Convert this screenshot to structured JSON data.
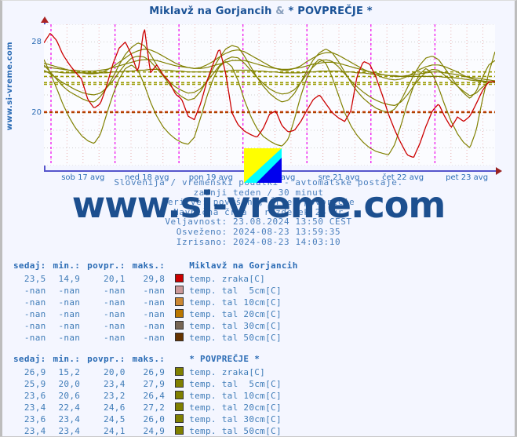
{
  "page": {
    "title": "Miklavž na Gorjancih & * POVPREČJE *",
    "title_left": "Miklavž na Gorjancih",
    "title_amp": "&",
    "title_right": "* POVPREČJE *",
    "vertical_watermark": "www.si-vreme.com",
    "big_watermark": "www.si-vreme.com",
    "logo_name": "si-vreme-logo"
  },
  "footer": {
    "line1": "Slovenija / vremenski podatki - avtomatske postaje.",
    "line2": "zadnji teden / 30 minut",
    "line3": "Meritve: površina, Črte: povprečje",
    "line4": "Navpična črta - razdelek 24 ur",
    "line5": "Veljavnost: 23.08.2024 13:50 CEST",
    "line6": "Osveženo: 2024-08-23 13:59:35",
    "line7": "Izrisano: 2024-08-23 14:03:10"
  },
  "chart_data": {
    "type": "line",
    "title": "Miklavž na Gorjancih & * POVPREČJE *",
    "xlabel": "",
    "ylabel": "",
    "ylim": [
      14,
      30
    ],
    "yticks": [
      20,
      28
    ],
    "ytick_labels": [
      "20",
      "28"
    ],
    "grid": true,
    "legend_position": "below-table",
    "x_tick_labels": [
      "sob 17 avg",
      "ned 18 avg",
      "pon 19 avg",
      "tor 20 avg",
      "sre 21 avg",
      "čet 22 avg",
      "pet 23 avg"
    ],
    "x_range": "2024-08-16 .. 2024-08-23",
    "series": [
      {
        "name": "Miklavž na Gorjancih temp. zraka[C]",
        "color": "#cc0000",
        "now": 23.5,
        "min": 14.9,
        "avg": 20.1,
        "max": 29.8,
        "values": [
          27.9,
          29.0,
          28.2,
          26.6,
          25.5,
          24.6,
          23.8,
          21.5,
          20.5,
          21.0,
          23.0,
          25.5,
          27.3,
          28.0,
          26.5,
          24.5,
          29.8,
          24.5,
          25.4,
          24.3,
          23.5,
          22.1,
          21.5,
          19.6,
          19.2,
          21.0,
          23.5,
          25.5,
          27.3,
          24.5,
          20.0,
          18.6,
          17.9,
          17.5,
          17.2,
          18.2,
          19.8,
          20.2,
          18.5,
          17.8,
          18.0,
          19.0,
          20.3,
          21.5,
          22.0,
          21.0,
          20.0,
          19.4,
          19.0,
          20.2,
          24.2,
          25.8,
          25.5,
          24.0,
          22.0,
          19.8,
          18.0,
          16.5,
          15.2,
          14.9,
          16.5,
          18.5,
          20.2,
          21.0,
          19.5,
          18.3,
          19.5,
          19.0,
          19.6,
          21.0,
          22.5,
          23.5,
          23.5
        ]
      },
      {
        "name": "Miklavž na Gorjancih temp. tal  5cm[C]",
        "color": "#cc9999",
        "now": "-nan",
        "min": "-nan",
        "avg": "-nan",
        "max": "-nan",
        "values": []
      },
      {
        "name": "Miklavž na Gorjancih temp. tal 10cm[C]",
        "color": "#cc8833",
        "now": "-nan",
        "min": "-nan",
        "avg": "-nan",
        "max": "-nan",
        "values": []
      },
      {
        "name": "Miklavž na Gorjancih temp. tal 20cm[C]",
        "color": "#bb7700",
        "now": "-nan",
        "min": "-nan",
        "avg": "-nan",
        "max": "-nan",
        "values": []
      },
      {
        "name": "Miklavž na Gorjancih temp. tal 30cm[C]",
        "color": "#776655",
        "now": "-nan",
        "min": "-nan",
        "avg": "-nan",
        "max": "-nan",
        "values": []
      },
      {
        "name": "Miklavž na Gorjancih temp. tal 50cm[C]",
        "color": "#663300",
        "now": "-nan",
        "min": "-nan",
        "avg": "-nan",
        "max": "-nan",
        "values": []
      },
      {
        "name": "* POVPREČJE * temp. zraka[C]",
        "color": "#808000",
        "now": 26.9,
        "min": 15.2,
        "avg": 20.0,
        "max": 26.9,
        "values": [
          26.0,
          24.5,
          22.8,
          21.0,
          19.5,
          18.3,
          17.4,
          16.8,
          16.5,
          17.5,
          19.8,
          22.0,
          23.8,
          25.0,
          25.4,
          24.8,
          23.2,
          21.2,
          19.6,
          18.4,
          17.6,
          17.0,
          16.6,
          16.4,
          17.2,
          19.4,
          21.8,
          23.8,
          25.2,
          25.8,
          25.2,
          23.6,
          21.4,
          19.6,
          18.2,
          17.3,
          16.8,
          16.4,
          16.2,
          17.0,
          19.3,
          21.9,
          24.0,
          25.4,
          26.1,
          25.6,
          24.0,
          22.0,
          20.0,
          18.5,
          17.4,
          16.6,
          16.0,
          15.6,
          15.4,
          15.2,
          16.4,
          18.6,
          21.0,
          23.0,
          24.4,
          25.0,
          24.4,
          22.8,
          20.8,
          19.0,
          17.6,
          16.6,
          16.0,
          18.0,
          21.5,
          24.5,
          26.9
        ]
      },
      {
        "name": "* POVPREČJE * temp. tal  5cm[C]",
        "color": "#808000",
        "now": 25.9,
        "min": 20.0,
        "avg": 23.4,
        "max": 27.9,
        "values": [
          25.4,
          24.6,
          23.8,
          23.0,
          22.4,
          22.0,
          21.6,
          21.3,
          21.2,
          21.8,
          22.8,
          24.0,
          25.4,
          26.6,
          27.4,
          27.9,
          27.6,
          26.6,
          25.4,
          24.2,
          23.2,
          22.4,
          21.8,
          21.4,
          21.6,
          22.4,
          23.6,
          25.0,
          26.2,
          27.2,
          27.6,
          27.4,
          26.4,
          25.2,
          24.0,
          23.0,
          22.2,
          21.6,
          21.2,
          21.4,
          22.2,
          23.4,
          24.8,
          26.0,
          26.8,
          27.2,
          26.8,
          25.8,
          24.6,
          23.4,
          22.4,
          21.6,
          21.0,
          20.5,
          20.2,
          20.0,
          20.4,
          21.4,
          22.8,
          24.2,
          25.4,
          26.2,
          26.4,
          26.0,
          25.0,
          24.0,
          23.0,
          22.2,
          21.6,
          22.4,
          24.0,
          25.4,
          25.9
        ]
      },
      {
        "name": "* POVPREČJE * temp. tal 10cm[C]",
        "color": "#808000",
        "now": 23.6,
        "min": 20.6,
        "avg": 23.2,
        "max": 26.4,
        "values": [
          24.8,
          24.4,
          23.9,
          23.4,
          23.0,
          22.6,
          22.3,
          22.1,
          22.0,
          22.2,
          22.8,
          23.6,
          24.6,
          25.5,
          26.2,
          26.4,
          26.3,
          25.8,
          25.0,
          24.2,
          23.5,
          22.9,
          22.5,
          22.2,
          22.3,
          22.7,
          23.5,
          24.4,
          25.3,
          26.0,
          26.3,
          26.2,
          25.6,
          24.8,
          24.0,
          23.3,
          22.7,
          22.3,
          22.1,
          22.2,
          22.6,
          23.4,
          24.4,
          25.2,
          25.8,
          26.0,
          25.8,
          25.2,
          24.4,
          23.6,
          22.9,
          22.3,
          21.8,
          21.4,
          21.1,
          20.9,
          20.8,
          21.2,
          22.0,
          23.0,
          23.9,
          24.6,
          24.9,
          24.8,
          24.2,
          23.6,
          23.0,
          22.4,
          21.9,
          22.2,
          22.9,
          23.4,
          23.6
        ]
      },
      {
        "name": "* POVPREČJE * temp. tal 20cm[C]",
        "color": "#808000",
        "now": 23.4,
        "min": 22.4,
        "avg": 24.6,
        "max": 27.2,
        "values": [
          25.6,
          25.4,
          25.2,
          25.0,
          24.8,
          24.6,
          24.5,
          24.4,
          24.4,
          24.5,
          24.8,
          25.2,
          25.7,
          26.2,
          26.7,
          27.0,
          27.2,
          27.1,
          26.8,
          26.4,
          26.0,
          25.6,
          25.3,
          25.1,
          25.0,
          25.1,
          25.4,
          25.8,
          26.3,
          26.7,
          27.0,
          27.1,
          26.9,
          26.5,
          26.1,
          25.7,
          25.3,
          25.0,
          24.8,
          24.8,
          25.0,
          25.3,
          25.8,
          26.2,
          26.6,
          26.8,
          26.8,
          26.5,
          26.1,
          25.7,
          25.3,
          24.9,
          24.6,
          24.3,
          24.0,
          23.8,
          23.7,
          23.8,
          24.1,
          24.5,
          24.9,
          25.2,
          25.4,
          25.4,
          25.2,
          24.9,
          24.6,
          24.2,
          23.9,
          23.7,
          23.6,
          23.5,
          23.4
        ]
      },
      {
        "name": "* POVPREČJE * temp. tal 30cm[C]",
        "color": "#808000",
        "now": 23.6,
        "min": 23.4,
        "avg": 24.5,
        "max": 26.0,
        "values": [
          25.2,
          25.1,
          25.0,
          24.9,
          24.8,
          24.8,
          24.7,
          24.7,
          24.7,
          24.8,
          24.9,
          25.1,
          25.3,
          25.5,
          25.7,
          25.9,
          26.0,
          26.0,
          25.9,
          25.7,
          25.5,
          25.3,
          25.2,
          25.1,
          25.0,
          25.0,
          25.1,
          25.3,
          25.5,
          25.7,
          25.9,
          25.9,
          25.9,
          25.7,
          25.5,
          25.3,
          25.1,
          25.0,
          24.9,
          24.9,
          25.0,
          25.1,
          25.3,
          25.5,
          25.6,
          25.7,
          25.7,
          25.6,
          25.4,
          25.2,
          25.0,
          24.8,
          24.6,
          24.5,
          24.3,
          24.2,
          24.1,
          24.1,
          24.2,
          24.3,
          24.4,
          24.5,
          24.6,
          24.6,
          24.5,
          24.4,
          24.3,
          24.1,
          24.0,
          23.9,
          23.8,
          23.7,
          23.6
        ]
      },
      {
        "name": "* POVPREČJE * temp. tal 50cm[C]",
        "color": "#808000",
        "now": 23.4,
        "min": 23.4,
        "avg": 24.1,
        "max": 24.9,
        "values": [
          24.6,
          24.6,
          24.6,
          24.5,
          24.5,
          24.5,
          24.5,
          24.5,
          24.5,
          24.5,
          24.5,
          24.6,
          24.6,
          24.7,
          24.7,
          24.8,
          24.8,
          24.9,
          24.9,
          24.8,
          24.8,
          24.7,
          24.7,
          24.6,
          24.6,
          24.6,
          24.6,
          24.6,
          24.7,
          24.7,
          24.8,
          24.8,
          24.8,
          24.8,
          24.7,
          24.7,
          24.6,
          24.6,
          24.5,
          24.5,
          24.5,
          24.5,
          24.6,
          24.6,
          24.7,
          24.7,
          24.7,
          24.7,
          24.6,
          24.6,
          24.5,
          24.5,
          24.4,
          24.3,
          24.3,
          24.2,
          24.2,
          24.1,
          24.1,
          24.1,
          24.1,
          24.1,
          24.1,
          24.1,
          24.0,
          24.0,
          23.9,
          23.8,
          23.7,
          23.6,
          23.5,
          23.5,
          23.4
        ]
      }
    ],
    "avg_reference_lines": [
      {
        "value": 24.6,
        "color": "#9a9a00"
      },
      {
        "value": 24.1,
        "color": "#9a9a00"
      },
      {
        "value": 23.4,
        "color": "#9a9a00"
      },
      {
        "value": 23.2,
        "color": "#9a9a00"
      },
      {
        "value": 20.1,
        "color": "#cc3300"
      },
      {
        "value": 20.0,
        "color": "#aa4400"
      }
    ]
  },
  "tables": [
    {
      "headers": [
        "sedaj:",
        "min.:",
        "povpr.:",
        "maks.:",
        "Miklavž na Gorjancih"
      ],
      "station": "Miklavž na Gorjancih",
      "rows": [
        {
          "now": "23,5",
          "min": "14,9",
          "avg": "20,1",
          "max": "29,8",
          "color": "#cc0000",
          "label": "temp. zraka[C]"
        },
        {
          "now": "-nan",
          "min": "-nan",
          "avg": "-nan",
          "max": "-nan",
          "color": "#cc9999",
          "label": "temp. tal  5cm[C]"
        },
        {
          "now": "-nan",
          "min": "-nan",
          "avg": "-nan",
          "max": "-nan",
          "color": "#cc8833",
          "label": "temp. tal 10cm[C]"
        },
        {
          "now": "-nan",
          "min": "-nan",
          "avg": "-nan",
          "max": "-nan",
          "color": "#bb7700",
          "label": "temp. tal 20cm[C]"
        },
        {
          "now": "-nan",
          "min": "-nan",
          "avg": "-nan",
          "max": "-nan",
          "color": "#776655",
          "label": "temp. tal 30cm[C]"
        },
        {
          "now": "-nan",
          "min": "-nan",
          "avg": "-nan",
          "max": "-nan",
          "color": "#663300",
          "label": "temp. tal 50cm[C]"
        }
      ]
    },
    {
      "headers": [
        "sedaj:",
        "min.:",
        "povpr.:",
        "maks.:",
        "* POVPREČJE *"
      ],
      "station": "* POVPREČJE *",
      "rows": [
        {
          "now": "26,9",
          "min": "15,2",
          "avg": "20,0",
          "max": "26,9",
          "color": "#808000",
          "label": "temp. zraka[C]"
        },
        {
          "now": "25,9",
          "min": "20,0",
          "avg": "23,4",
          "max": "27,9",
          "color": "#808000",
          "label": "temp. tal  5cm[C]"
        },
        {
          "now": "23,6",
          "min": "20,6",
          "avg": "23,2",
          "max": "26,4",
          "color": "#808000",
          "label": "temp. tal 10cm[C]"
        },
        {
          "now": "23,4",
          "min": "22,4",
          "avg": "24,6",
          "max": "27,2",
          "color": "#808000",
          "label": "temp. tal 20cm[C]"
        },
        {
          "now": "23,6",
          "min": "23,4",
          "avg": "24,5",
          "max": "26,0",
          "color": "#808000",
          "label": "temp. tal 30cm[C]"
        },
        {
          "now": "23,4",
          "min": "23,4",
          "avg": "24,1",
          "max": "24,9",
          "color": "#808000",
          "label": "temp. tal 50cm[C]"
        }
      ]
    }
  ]
}
